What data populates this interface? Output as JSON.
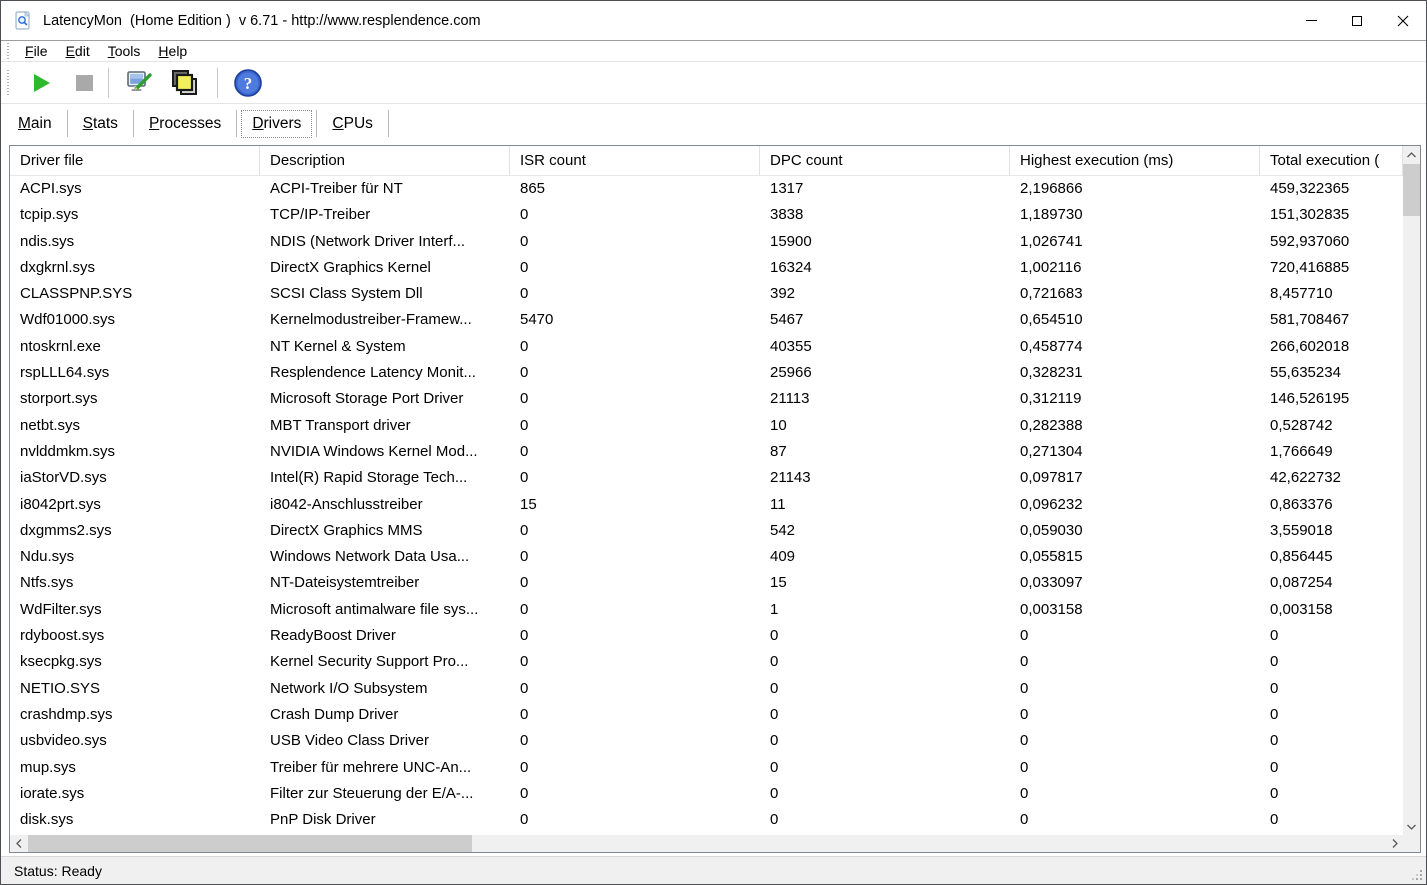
{
  "window": {
    "title": "LatencyMon  (Home Edition )  v 6.71 - http://www.resplendence.com"
  },
  "menu": {
    "items": [
      "File",
      "Edit",
      "Tools",
      "Help"
    ]
  },
  "toolbar": {
    "buttons": [
      {
        "name": "start-monitor",
        "icon": "play-icon"
      },
      {
        "name": "stop-monitor",
        "icon": "stop-icon"
      },
      {
        "name": "options",
        "icon": "monitor-tool-icon"
      },
      {
        "name": "report",
        "icon": "copy-pages-icon"
      },
      {
        "name": "help",
        "icon": "help-icon"
      }
    ]
  },
  "tabs": [
    {
      "label": "Main",
      "active": false
    },
    {
      "label": "Stats",
      "active": false
    },
    {
      "label": "Processes",
      "active": false
    },
    {
      "label": "Drivers",
      "active": true
    },
    {
      "label": "CPUs",
      "active": false
    }
  ],
  "table": {
    "columns": [
      "Driver file",
      "Description",
      "ISR count",
      "DPC count",
      "Highest execution (ms)",
      "Total execution ("
    ],
    "rows": [
      {
        "file": "ACPI.sys",
        "description": "ACPI-Treiber für NT",
        "isr": "865",
        "dpc": "1317",
        "highest": "2,196866",
        "total": "459,322365"
      },
      {
        "file": "tcpip.sys",
        "description": "TCP/IP-Treiber",
        "isr": "0",
        "dpc": "3838",
        "highest": "1,189730",
        "total": "151,302835"
      },
      {
        "file": "ndis.sys",
        "description": "NDIS (Network Driver Interf...",
        "isr": "0",
        "dpc": "15900",
        "highest": "1,026741",
        "total": "592,937060"
      },
      {
        "file": "dxgkrnl.sys",
        "description": "DirectX Graphics Kernel",
        "isr": "0",
        "dpc": "16324",
        "highest": "1,002116",
        "total": "720,416885"
      },
      {
        "file": "CLASSPNP.SYS",
        "description": "SCSI Class System Dll",
        "isr": "0",
        "dpc": "392",
        "highest": "0,721683",
        "total": "8,457710"
      },
      {
        "file": "Wdf01000.sys",
        "description": "Kernelmodustreiber-Framew...",
        "isr": "5470",
        "dpc": "5467",
        "highest": "0,654510",
        "total": "581,708467"
      },
      {
        "file": "ntoskrnl.exe",
        "description": "NT Kernel & System",
        "isr": "0",
        "dpc": "40355",
        "highest": "0,458774",
        "total": "266,602018"
      },
      {
        "file": "rspLLL64.sys",
        "description": "Resplendence Latency Monit...",
        "isr": "0",
        "dpc": "25966",
        "highest": "0,328231",
        "total": "55,635234"
      },
      {
        "file": "storport.sys",
        "description": "Microsoft Storage Port Driver",
        "isr": "0",
        "dpc": "21113",
        "highest": "0,312119",
        "total": "146,526195"
      },
      {
        "file": "netbt.sys",
        "description": "MBT Transport driver",
        "isr": "0",
        "dpc": "10",
        "highest": "0,282388",
        "total": "0,528742"
      },
      {
        "file": "nvlddmkm.sys",
        "description": "NVIDIA Windows Kernel Mod...",
        "isr": "0",
        "dpc": "87",
        "highest": "0,271304",
        "total": "1,766649"
      },
      {
        "file": "iaStorVD.sys",
        "description": "Intel(R) Rapid Storage Tech...",
        "isr": "0",
        "dpc": "21143",
        "highest": "0,097817",
        "total": "42,622732"
      },
      {
        "file": "i8042prt.sys",
        "description": "i8042-Anschlusstreiber",
        "isr": "15",
        "dpc": "11",
        "highest": "0,096232",
        "total": "0,863376"
      },
      {
        "file": "dxgmms2.sys",
        "description": "DirectX Graphics MMS",
        "isr": "0",
        "dpc": "542",
        "highest": "0,059030",
        "total": "3,559018"
      },
      {
        "file": "Ndu.sys",
        "description": "Windows Network Data Usa...",
        "isr": "0",
        "dpc": "409",
        "highest": "0,055815",
        "total": "0,856445"
      },
      {
        "file": "Ntfs.sys",
        "description": "NT-Dateisystemtreiber",
        "isr": "0",
        "dpc": "15",
        "highest": "0,033097",
        "total": "0,087254"
      },
      {
        "file": "WdFilter.sys",
        "description": "Microsoft antimalware file sys...",
        "isr": "0",
        "dpc": "1",
        "highest": "0,003158",
        "total": "0,003158"
      },
      {
        "file": "rdyboost.sys",
        "description": "ReadyBoost Driver",
        "isr": "0",
        "dpc": "0",
        "highest": "0",
        "total": "0"
      },
      {
        "file": "ksecpkg.sys",
        "description": "Kernel Security Support Pro...",
        "isr": "0",
        "dpc": "0",
        "highest": "0",
        "total": "0"
      },
      {
        "file": "NETIO.SYS",
        "description": "Network I/O Subsystem",
        "isr": "0",
        "dpc": "0",
        "highest": "0",
        "total": "0"
      },
      {
        "file": "crashdmp.sys",
        "description": "Crash Dump Driver",
        "isr": "0",
        "dpc": "0",
        "highest": "0",
        "total": "0"
      },
      {
        "file": "usbvideo.sys",
        "description": "USB Video Class Driver",
        "isr": "0",
        "dpc": "0",
        "highest": "0",
        "total": "0"
      },
      {
        "file": "mup.sys",
        "description": "Treiber für mehrere UNC-An...",
        "isr": "0",
        "dpc": "0",
        "highest": "0",
        "total": "0"
      },
      {
        "file": "iorate.sys",
        "description": "Filter zur Steuerung der E/A-...",
        "isr": "0",
        "dpc": "0",
        "highest": "0",
        "total": "0"
      },
      {
        "file": "disk.sys",
        "description": "PnP Disk Driver",
        "isr": "0",
        "dpc": "0",
        "highest": "0",
        "total": "0"
      }
    ]
  },
  "status_bar": {
    "text": "Status: Ready"
  },
  "colors": {
    "play_green": "#2eb82e",
    "stop_gray": "#a9a9a9",
    "help_blue": "#2f5bd7",
    "scrollbar_track": "#f0f0f0",
    "scrollbar_thumb": "#cdcdcd"
  }
}
